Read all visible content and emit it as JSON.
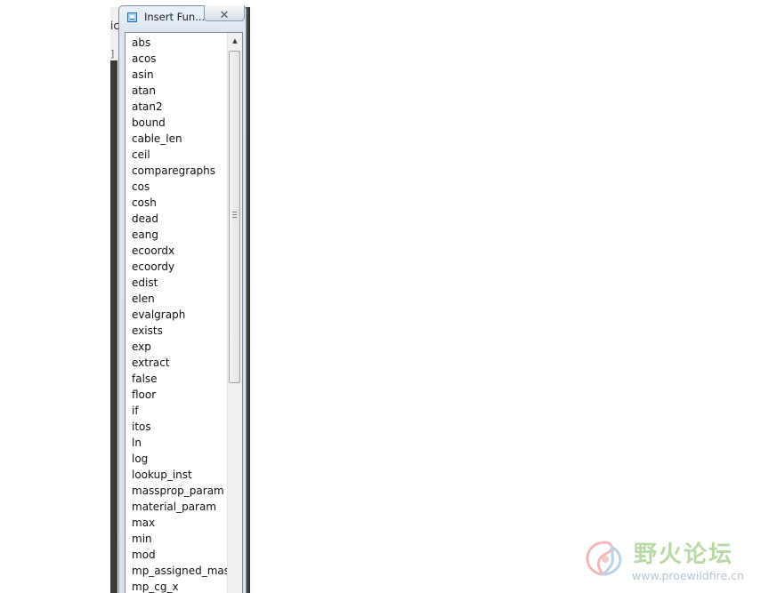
{
  "background_app": {
    "title_fragment": "ic",
    "toolbar_fragment": "]"
  },
  "dialog": {
    "title": "Insert Fun...",
    "close_label": "✕"
  },
  "function_list": {
    "items": [
      "abs",
      "acos",
      "asin",
      "atan",
      "atan2",
      "bound",
      "cable_len",
      "ceil",
      "comparegraphs",
      "cos",
      "cosh",
      "dead",
      "eang",
      "ecoordx",
      "ecoordy",
      "edist",
      "elen",
      "evalgraph",
      "exists",
      "exp",
      "extract",
      "false",
      "floor",
      "if",
      "itos",
      "ln",
      "log",
      "lookup_inst",
      "massprop_param",
      "material_param",
      "max",
      "min",
      "mod",
      "mp_assigned_mass",
      "mp_cg_x"
    ]
  },
  "scrollbar": {
    "up_arrow": "▲",
    "grip_icon": "grip-lines-icon"
  },
  "watermark": {
    "title": "野火论坛",
    "url": "www.proewildfire.cn"
  },
  "colors": {
    "dialog_border": "#7a8ea6",
    "watermark_green": "#b9d9a6",
    "watermark_blue": "#b7c6d2"
  }
}
